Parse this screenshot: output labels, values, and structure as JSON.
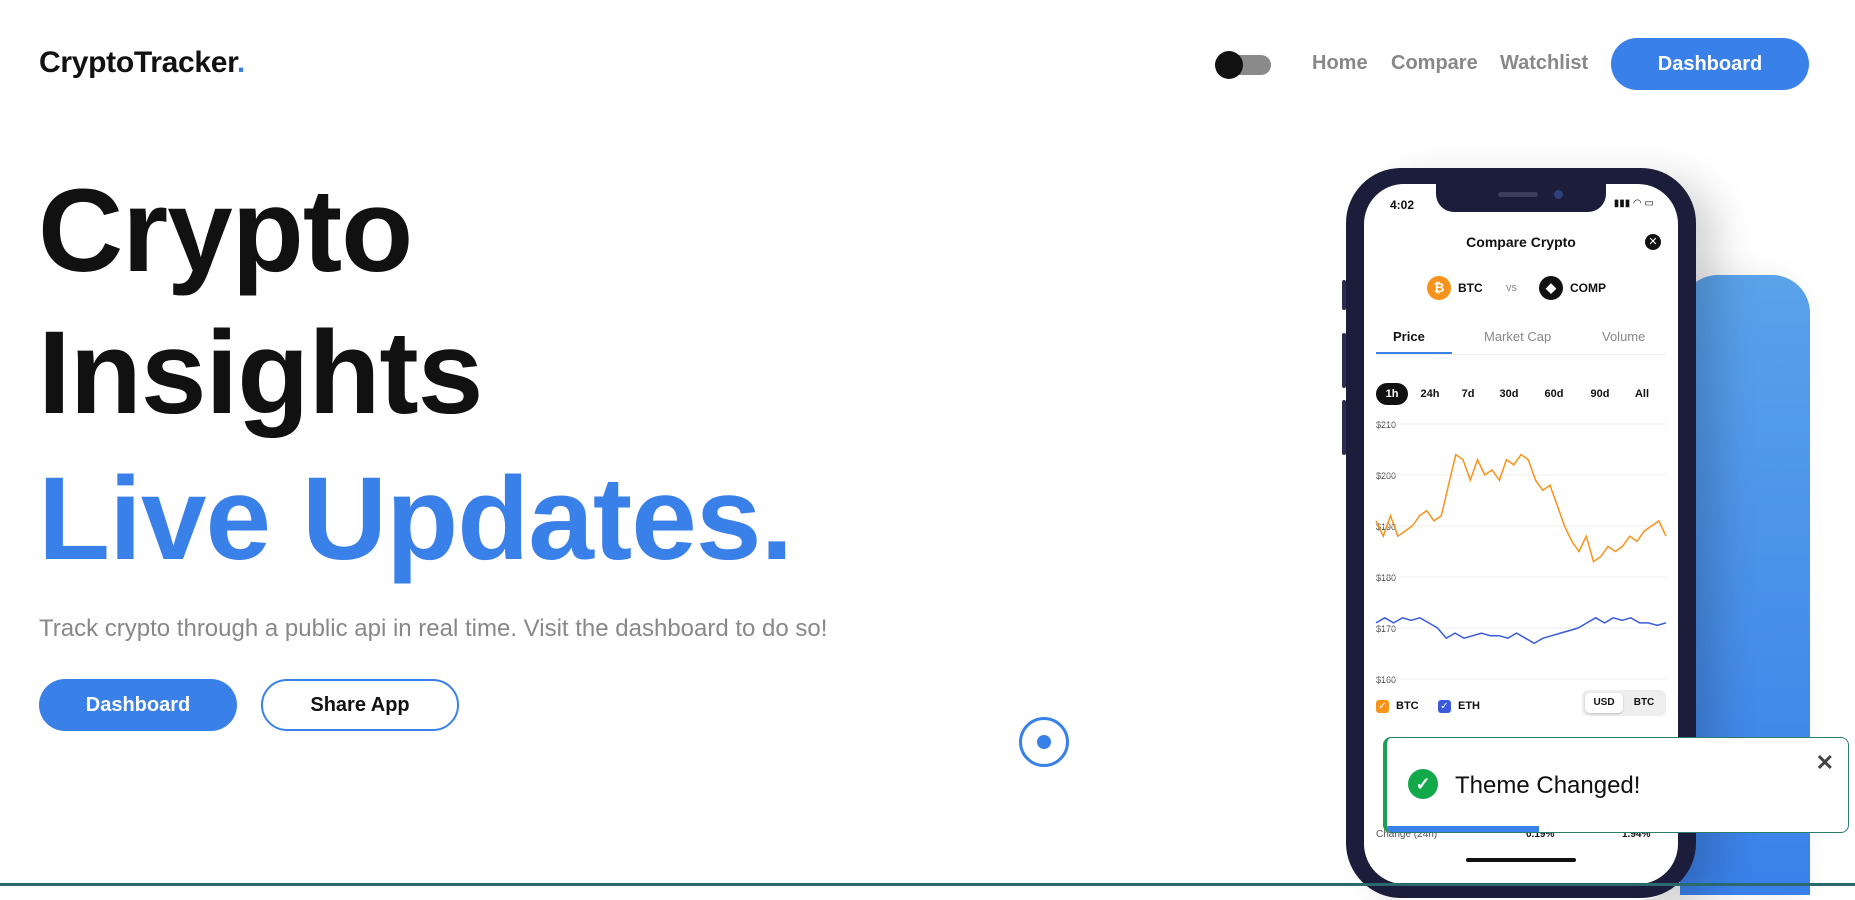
{
  "header": {
    "logo": "CryptoTracker",
    "logo_dot": ".",
    "nav": [
      "Home",
      "Compare",
      "Watchlist"
    ],
    "cta": "Dashboard"
  },
  "hero": {
    "line1": "Crypto",
    "line2": "Insights",
    "line3": "Live Updates.",
    "subtitle": "Track crypto through a public api in real time. Visit the dashboard to do so!",
    "primary_button": "Dashboard",
    "secondary_button": "Share App"
  },
  "phone": {
    "time": "4:02",
    "status_icons": "▮▮▮ ◠ ▭",
    "title": "Compare Crypto",
    "close": "✕",
    "coin1": {
      "symbol": "BTC",
      "icon": "₿",
      "color": "#f7931a"
    },
    "vs": "vs",
    "coin2": {
      "symbol": "COMP",
      "icon": "◆",
      "color": "#111111"
    },
    "tabs": [
      "Price",
      "Market Cap",
      "Volume"
    ],
    "ranges": [
      "1h",
      "24h",
      "7d",
      "30d",
      "60d",
      "90d",
      "All"
    ],
    "legend": [
      {
        "label": "BTC",
        "color": "#f7931a"
      },
      {
        "label": "ETH",
        "color": "#3a5bdc"
      }
    ],
    "currency": [
      "USD",
      "BTC"
    ],
    "row_label": "Change (24h)",
    "row_values": [
      "0.19%",
      "1.94%"
    ]
  },
  "chart_data": {
    "type": "line",
    "y_ticks": [
      "$210",
      "$200",
      "$190",
      "$180",
      "$170",
      "$160"
    ],
    "ylim": [
      160,
      210
    ],
    "series": [
      {
        "name": "BTC",
        "color": "#f7931a",
        "values": [
          191,
          188,
          192,
          188,
          189,
          190,
          192,
          193,
          191,
          192,
          198,
          204,
          203,
          199,
          203,
          200,
          201,
          199,
          203,
          202,
          204,
          203,
          199,
          197,
          198,
          194,
          190,
          187,
          185,
          188,
          183,
          184,
          186,
          185,
          186,
          188,
          187,
          189,
          190,
          191,
          188
        ]
      },
      {
        "name": "ETH",
        "color": "#3a5bdc",
        "values": [
          171,
          172,
          171,
          172,
          171.5,
          172,
          171,
          170,
          168,
          169,
          168,
          168.5,
          169,
          168.5,
          168.5,
          168,
          169,
          168,
          167,
          168,
          168.5,
          169,
          169.5,
          170,
          171,
          172,
          171,
          172,
          171.5,
          172,
          171,
          171,
          170.5,
          171
        ]
      }
    ]
  },
  "toast": {
    "icon": "✓",
    "message": "Theme Changed!",
    "close": "✕",
    "progress": 0.33
  }
}
